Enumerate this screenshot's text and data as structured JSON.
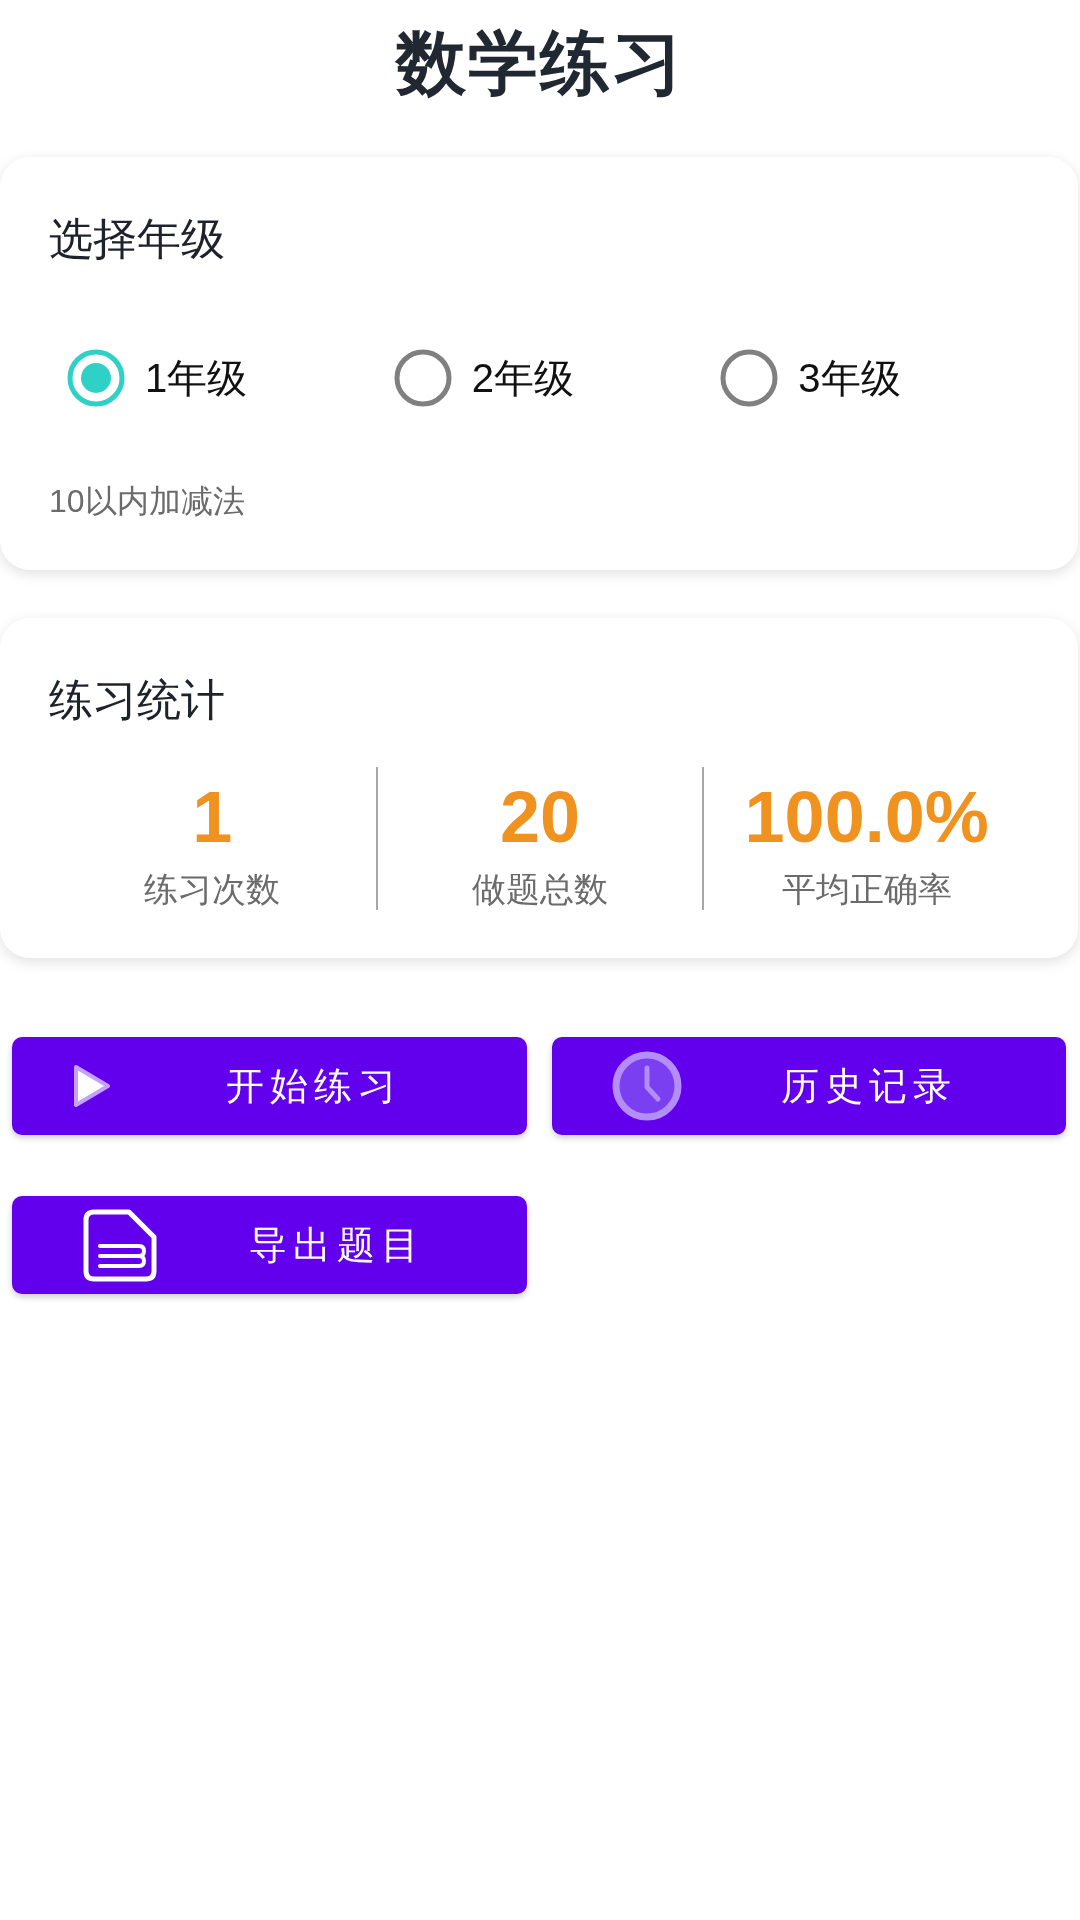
{
  "header": {
    "title": "数学练习"
  },
  "grade_card": {
    "title": "选择年级",
    "options": [
      {
        "label": "1年级",
        "selected": true
      },
      {
        "label": "2年级",
        "selected": false
      },
      {
        "label": "3年级",
        "selected": false
      }
    ],
    "description": "10以内加减法"
  },
  "stats_card": {
    "title": "练习统计",
    "stats": [
      {
        "value": "1",
        "label": "练习次数"
      },
      {
        "value": "20",
        "label": "做题总数"
      },
      {
        "value": "100.0%",
        "label": "平均正确率"
      }
    ]
  },
  "buttons": [
    {
      "label": "开始练习"
    },
    {
      "label": "历史记录"
    },
    {
      "label": "导出题目"
    }
  ]
}
